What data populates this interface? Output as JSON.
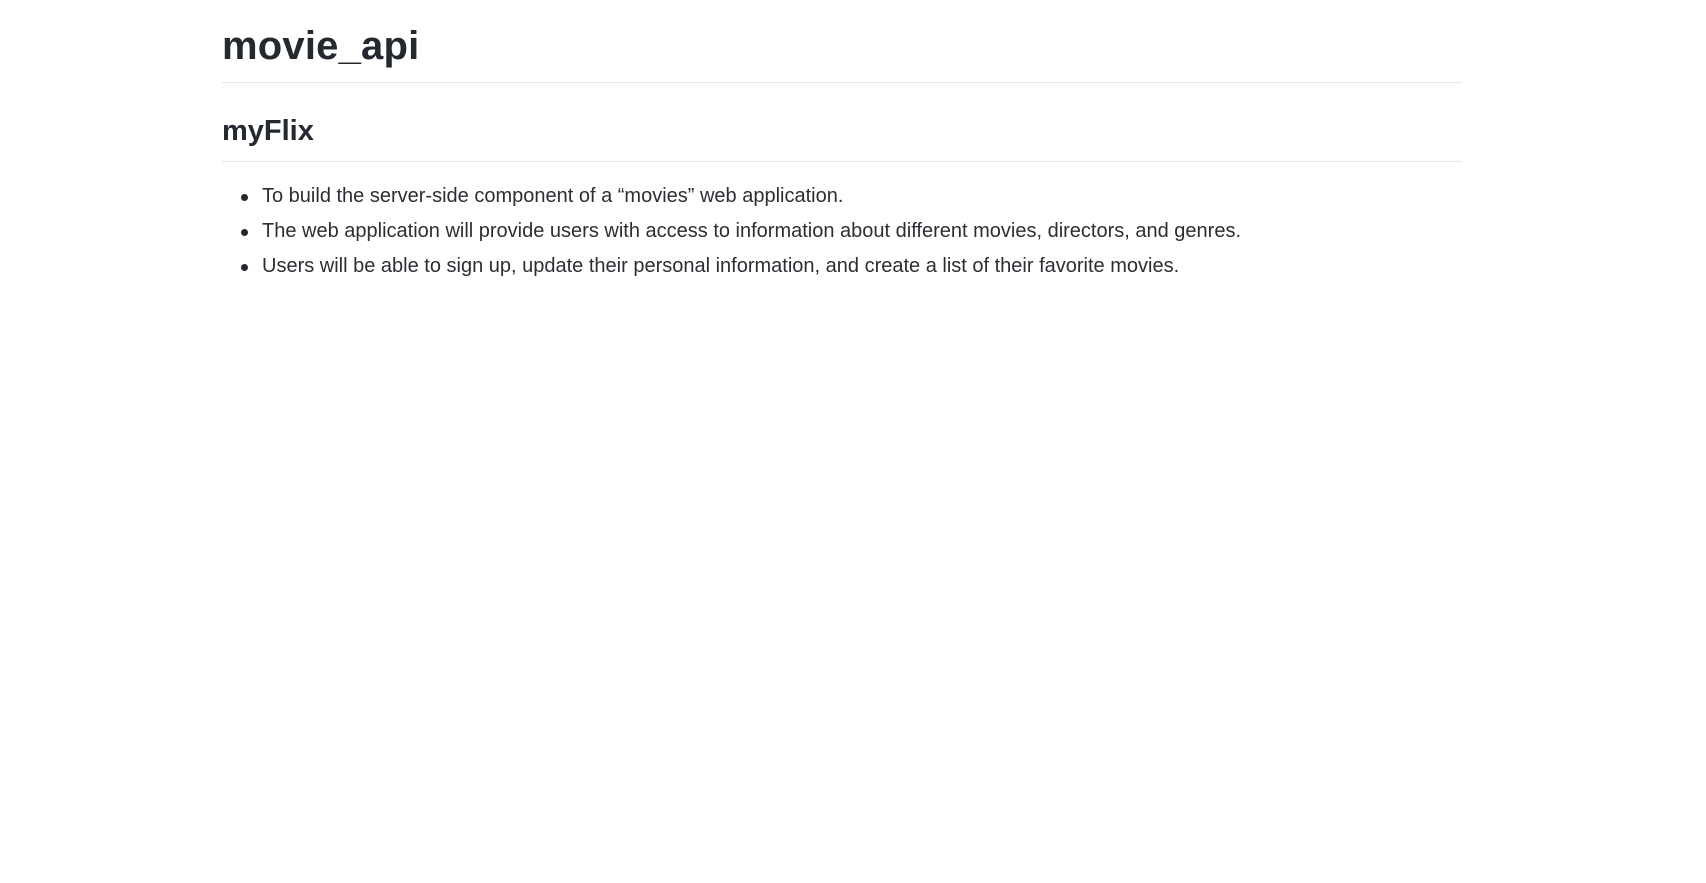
{
  "readme": {
    "title": "movie_api",
    "section": {
      "heading": "myFlix",
      "items": [
        "To build the server-side component of a “movies” web application.",
        "The web application will provide users with access to information about different movies, directors, and genres.",
        "Users will be able to sign up, update their personal information, and create a list of their favorite movies."
      ]
    }
  }
}
